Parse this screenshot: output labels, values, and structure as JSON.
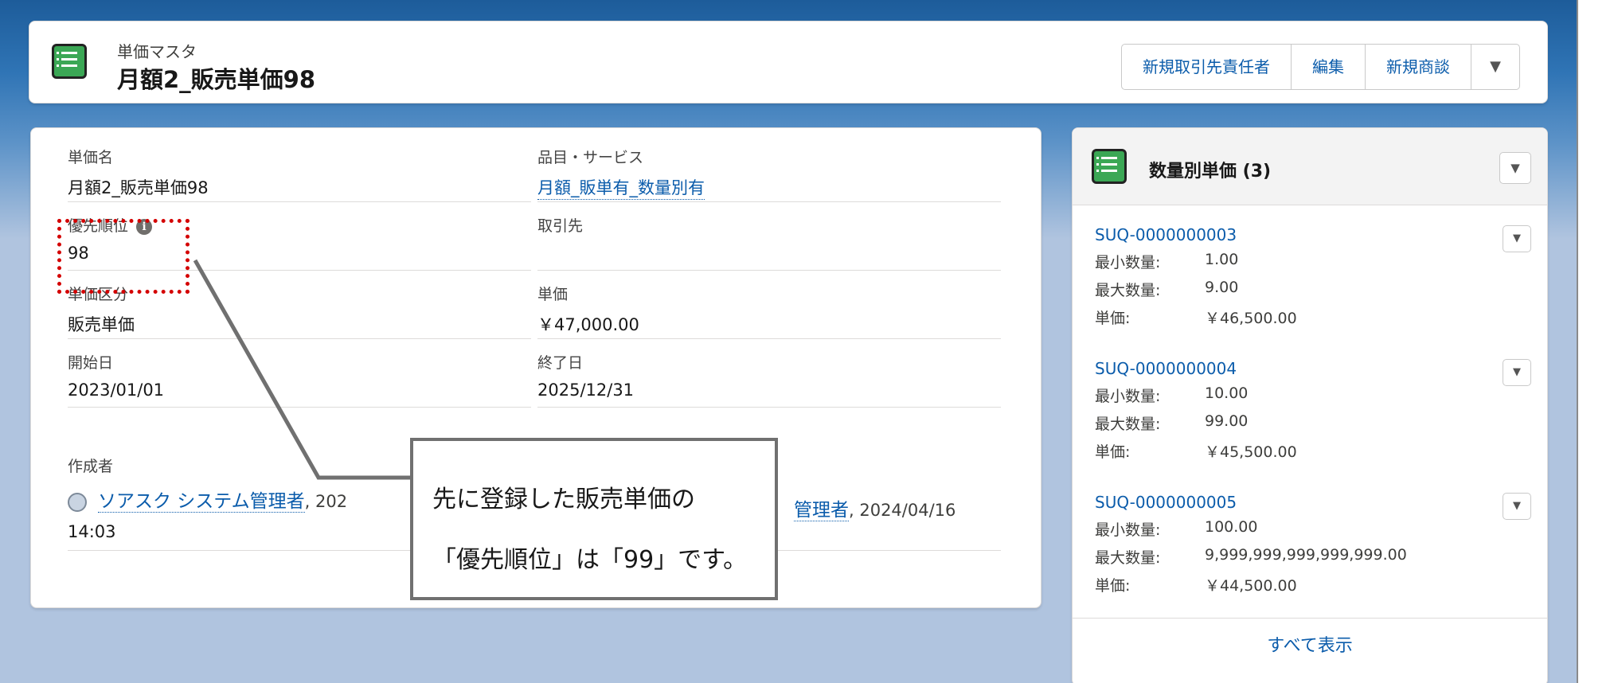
{
  "header": {
    "object_type": "単価マスタ",
    "title": "月額2_販売単価98",
    "buttons": [
      "新規取引先責任者",
      "編集",
      "新規商談"
    ]
  },
  "detail": {
    "fields": [
      {
        "label": "単価名",
        "value": "月額2_販売単価98"
      },
      {
        "label": "品目・サービス",
        "value": "月額_販単有_数量別有"
      },
      {
        "label": "優先順位",
        "value": "98"
      },
      {
        "label": "取引先",
        "value": ""
      },
      {
        "label": "単価区分",
        "value": "販売単価"
      },
      {
        "label": "単価",
        "value": "￥47,000.00"
      },
      {
        "label": "開始日",
        "value": "2023/01/01"
      },
      {
        "label": "終了日",
        "value": "2025/12/31"
      }
    ],
    "created_by": {
      "label": "作成者",
      "user": "ソアスク システム管理者",
      "date_partial": ", 202",
      "time": "14:03"
    },
    "modified_by": {
      "user_partial": "管理者",
      "date": ", 2024/04/16"
    }
  },
  "callout": {
    "line1": "先に登録した販売単価の",
    "line2": "「優先順位」は「99」です。"
  },
  "related": {
    "title": "数量別単価 (3)",
    "labels": {
      "min": "最小数量:",
      "max": "最大数量:",
      "price": "単価:"
    },
    "records": [
      {
        "id": "SUQ-0000000003",
        "min": "1.00",
        "max": "9.00",
        "price": "￥46,500.00"
      },
      {
        "id": "SUQ-0000000004",
        "min": "10.00",
        "max": "99.00",
        "price": "￥45,500.00"
      },
      {
        "id": "SUQ-0000000005",
        "min": "100.00",
        "max": "9,999,999,999,999,999.00",
        "price": "￥44,500.00"
      }
    ],
    "view_all": "すべて表示"
  },
  "colors": {
    "accent": "#0b5cab",
    "icon": "#3ba755",
    "highlight": "#d40000"
  }
}
